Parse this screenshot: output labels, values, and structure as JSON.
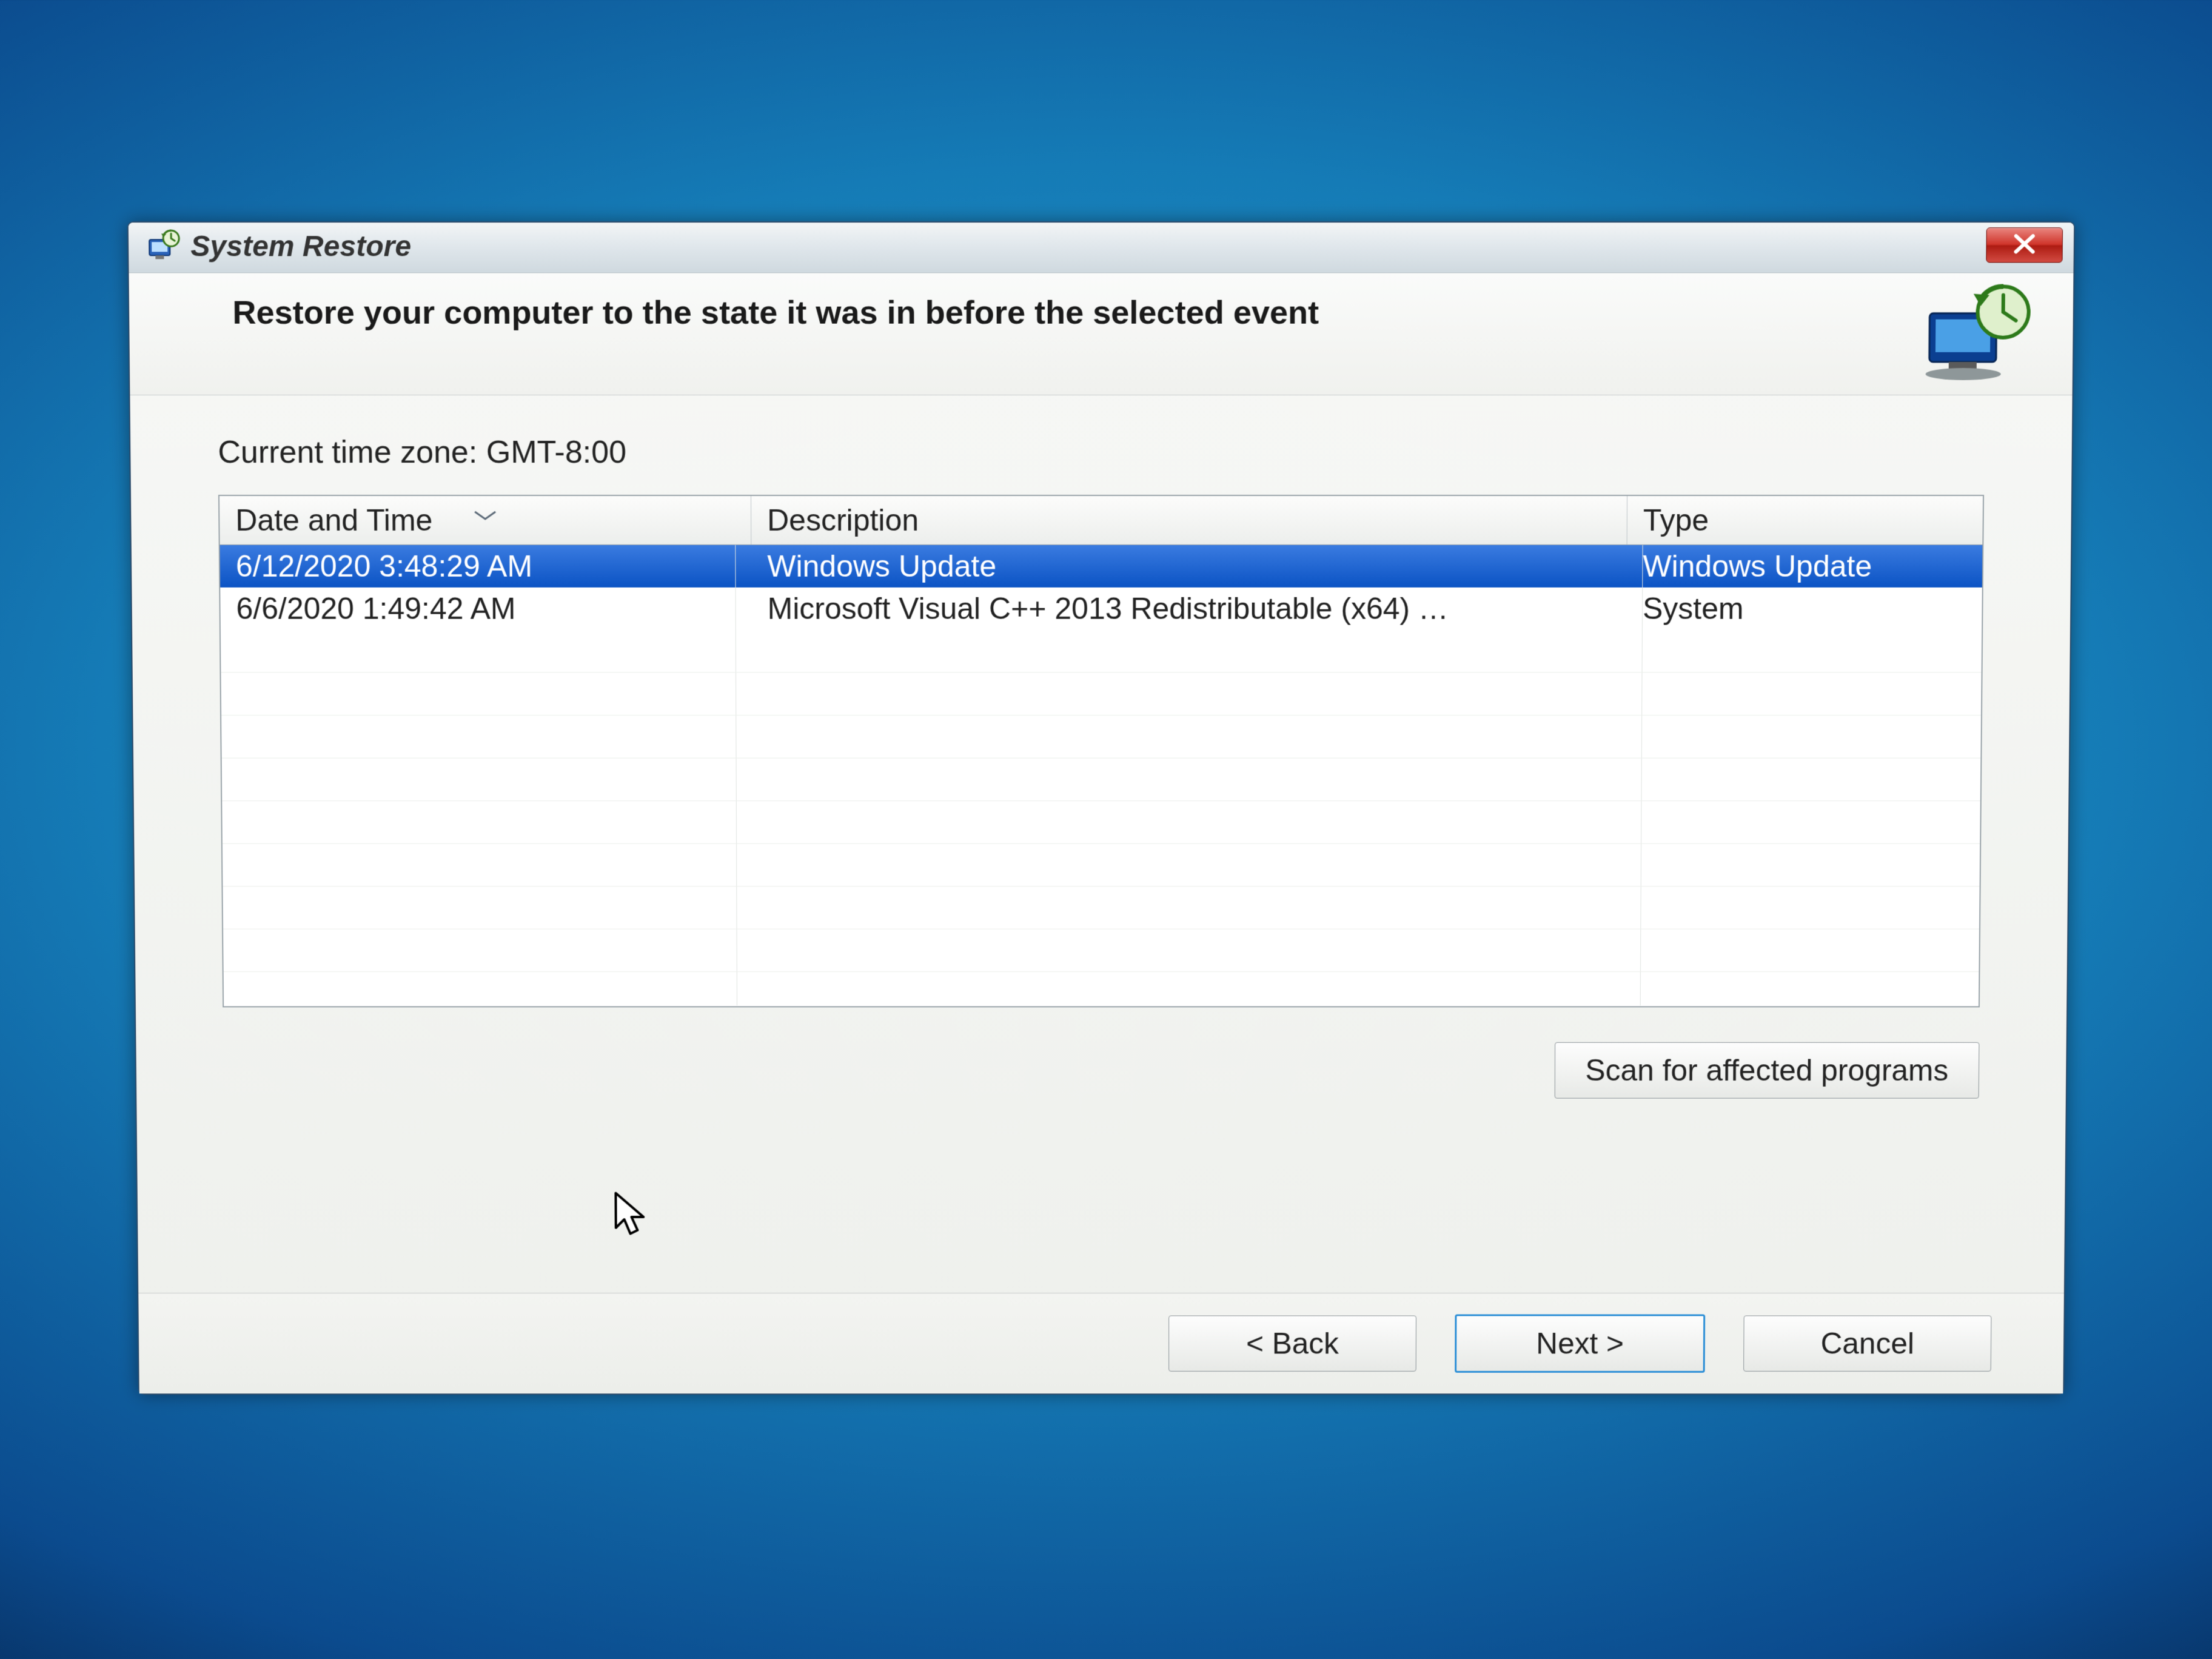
{
  "window": {
    "title": "System Restore"
  },
  "header": {
    "heading": "Restore your computer to the state it was in before the selected event"
  },
  "timezone_label": "Current time zone: GMT-8:00",
  "columns": {
    "date": "Date and Time",
    "desc": "Description",
    "type": "Type"
  },
  "restore_points": [
    {
      "date": "6/12/2020 3:48:29 AM",
      "desc": "Windows Update",
      "type": "Windows Update",
      "selected": true
    },
    {
      "date": "6/6/2020 1:49:42 AM",
      "desc": "Microsoft Visual C++ 2013 Redistributable (x64) …",
      "type": "System",
      "selected": false
    }
  ],
  "buttons": {
    "scan": "Scan for affected programs",
    "back": "< Back",
    "next": "Next >",
    "cancel": "Cancel"
  }
}
